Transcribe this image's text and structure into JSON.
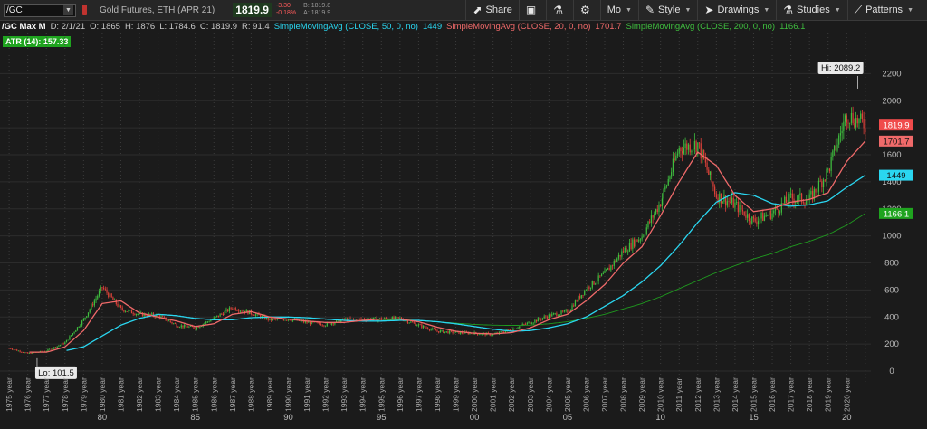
{
  "toolbar": {
    "symbol": "/GC",
    "description": "Gold Futures, ETH (APR 21)",
    "last": "1819.9",
    "change": "-3.30",
    "change_pct": "-0.18%",
    "bid": "B: 1819.8",
    "ask": "A: 1819.9",
    "buttons": [
      {
        "icon": "share-icon",
        "glyph": "⬈",
        "label": "Share"
      },
      {
        "icon": "camera-icon",
        "glyph": "▣",
        "label": ""
      },
      {
        "icon": "flask-icon",
        "glyph": "⚗",
        "label": ""
      },
      {
        "icon": "gear-icon",
        "glyph": "⚙",
        "label": ""
      },
      {
        "icon": "",
        "glyph": "",
        "label": "Mo"
      },
      {
        "icon": "brush-icon",
        "glyph": "✎",
        "label": "Style"
      },
      {
        "icon": "cursor-icon",
        "glyph": "➤",
        "label": "Drawings"
      },
      {
        "icon": "flask-icon",
        "glyph": "⚗",
        "label": "Studies"
      },
      {
        "icon": "pattern-icon",
        "glyph": "⟋",
        "label": "Patterns"
      }
    ]
  },
  "infobar": {
    "chart_name": "/GC Max M",
    "date": "D: 2/1/21",
    "open": "O: 1865",
    "high": "H: 1876",
    "low": "L: 1784.6",
    "close": "C: 1819.9",
    "range": "R: 91.4",
    "sma50_label": "SimpleMovingAvg (CLOSE, 50, 0, no)",
    "sma50_value": "1449",
    "sma20_label": "SimpleMovingAvg (CLOSE, 20, 0, no)",
    "sma20_value": "1701.7",
    "sma200_label": "SimpleMovingAvg (CLOSE, 200, 0, no)",
    "sma200_value": "1166.1"
  },
  "atr_label": "ATR (14): 157.33",
  "colors": {
    "up": "#3fbf3f",
    "down": "#e0413a",
    "sma50": "#2ad6f0",
    "sma20": "#f06a6a",
    "sma200": "#1f9a1f",
    "price_label": "#f04b4b"
  },
  "chart_data": {
    "type": "line",
    "x": [
      1975,
      1976,
      1977,
      1978,
      1979,
      1980,
      1981,
      1982,
      1983,
      1984,
      1985,
      1986,
      1987,
      1988,
      1989,
      1990,
      1991,
      1992,
      1993,
      1994,
      1995,
      1996,
      1997,
      1998,
      1999,
      2000,
      2001,
      2002,
      2003,
      2004,
      2005,
      2006,
      2007,
      2008,
      2009,
      2010,
      2011,
      2012,
      2013,
      2014,
      2015,
      2016,
      2017,
      2018,
      2019,
      2020,
      2021
    ],
    "series": [
      {
        "name": "",
        "values": [
          170,
          130,
          150,
          210,
          380,
          620,
          460,
          420,
          410,
          340,
          320,
          390,
          470,
          430,
          380,
          385,
          360,
          345,
          380,
          385,
          385,
          390,
          340,
          295,
          285,
          280,
          270,
          310,
          360,
          410,
          440,
          610,
          720,
          890,
          1000,
          1250,
          1650,
          1680,
          1300,
          1230,
          1110,
          1170,
          1280,
          1270,
          1480,
          1900,
          1820
        ]
      },
      {
        "name": "SimpleMovingAvg (CLOSE, 50, 0, no)",
        "values": [
          null,
          null,
          null,
          150,
          180,
          260,
          340,
          390,
          420,
          410,
          390,
          380,
          380,
          395,
          400,
          400,
          395,
          385,
          375,
          370,
          370,
          375,
          375,
          365,
          350,
          330,
          310,
          295,
          300,
          320,
          350,
          400,
          480,
          560,
          660,
          780,
          930,
          1100,
          1250,
          1320,
          1300,
          1240,
          1220,
          1230,
          1260,
          1360,
          1449
        ]
      },
      {
        "name": "SimpleMovingAvg (CLOSE, 20, 0, no)",
        "values": [
          null,
          140,
          140,
          180,
          300,
          500,
          520,
          430,
          400,
          370,
          330,
          350,
          420,
          440,
          400,
          385,
          370,
          360,
          360,
          375,
          385,
          385,
          365,
          325,
          295,
          280,
          275,
          285,
          320,
          380,
          420,
          520,
          640,
          800,
          920,
          1150,
          1400,
          1620,
          1520,
          1300,
          1180,
          1200,
          1250,
          1270,
          1320,
          1550,
          1701.7
        ]
      },
      {
        "name": "SimpleMovingAvg (CLOSE, 200, 0, no)",
        "values": [
          null,
          null,
          null,
          null,
          null,
          null,
          null,
          null,
          null,
          null,
          null,
          null,
          null,
          null,
          null,
          null,
          null,
          null,
          null,
          null,
          380,
          380,
          375,
          365,
          355,
          345,
          340,
          338,
          340,
          350,
          365,
          390,
          420,
          460,
          500,
          550,
          610,
          670,
          730,
          780,
          830,
          870,
          920,
          960,
          1010,
          1080,
          1166.1
        ]
      }
    ],
    "hi_label": "Hi: 2089.2",
    "lo_label": "Lo: 101.5",
    "hi": {
      "x": 2020.6,
      "y": 2089.2
    },
    "lo": {
      "x": 1976.5,
      "y": 101.5
    },
    "price_labels": [
      {
        "label": "1819.9",
        "y": 1819.9,
        "color": "#f04b4b",
        "text_color": "#ffffff"
      },
      {
        "label": "1701.7",
        "y": 1701.7,
        "color": "#f06a6a",
        "text_color": "#111111"
      },
      {
        "label": "1449",
        "y": 1449,
        "color": "#2ad6f0",
        "text_color": "#111111"
      },
      {
        "label": "1166.1",
        "y": 1166.1,
        "color": "#1fa41f",
        "text_color": "#ffffff"
      }
    ],
    "yticks": [
      0,
      200,
      400,
      600,
      800,
      1000,
      1200,
      1400,
      1600,
      1800,
      2000,
      2200
    ],
    "ytick_labels": [
      "0",
      "200",
      "400",
      "600",
      "800",
      "1000",
      "1200",
      "1400",
      "1600",
      "1800",
      "2000",
      "2200"
    ],
    "ylim": [
      -100,
      2350
    ],
    "xlim": [
      1974.8,
      2021.3
    ],
    "year_labels": [
      "1975 year",
      "1976 year",
      "1977 year",
      "1978 year",
      "1979 year",
      "1980 year",
      "1981 year",
      "1982 year",
      "1983 year",
      "1984 year",
      "1985 year",
      "1986 year",
      "1987 year",
      "1988 year",
      "1989 year",
      "1990 year",
      "1991 year",
      "1992 year",
      "1993 year",
      "1994 year",
      "1995 year",
      "1996 year",
      "1997 year",
      "1998 year",
      "1999 year",
      "2000 year",
      "2001 year",
      "2002 year",
      "2003 year",
      "2004 year",
      "2005 year",
      "2006 year",
      "2007 year",
      "2008 year",
      "2009 year",
      "2010 year",
      "2011 year",
      "2012 year",
      "2013 year",
      "2014 year",
      "2015 year",
      "2016 year",
      "2017 year",
      "2018 year",
      "2019 year",
      "2020 year"
    ],
    "xticks": [
      1980,
      1985,
      1990,
      1995,
      2000,
      2005,
      2010,
      2015,
      2020
    ],
    "xtick_labels": [
      "80",
      "85",
      "90",
      "95",
      "00",
      "05",
      "10",
      "15",
      "20"
    ],
    "grid": true
  }
}
